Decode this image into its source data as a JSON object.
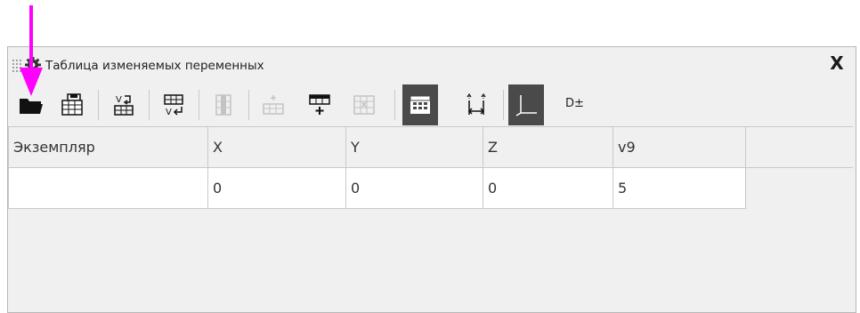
{
  "window": {
    "title": "Таблица изменяемых переменных",
    "close_label": "X"
  },
  "toolbar": {
    "buttons": [
      {
        "icon": "open-folder-icon",
        "state": "enabled"
      },
      {
        "icon": "save-table-icon",
        "state": "enabled"
      },
      {
        "icon": "import-variables-icon",
        "state": "enabled"
      },
      {
        "icon": "export-variables-icon",
        "state": "enabled"
      },
      {
        "icon": "columns-icon",
        "state": "disabled"
      },
      {
        "icon": "add-row-icon",
        "state": "disabled"
      },
      {
        "icon": "insert-row-icon",
        "state": "enabled"
      },
      {
        "icon": "delete-row-icon",
        "state": "disabled"
      },
      {
        "icon": "table-view-icon",
        "state": "active"
      },
      {
        "icon": "dimension-icon",
        "state": "enabled"
      },
      {
        "icon": "axes-icon",
        "state": "active"
      }
    ],
    "tolerance_label": "D±"
  },
  "table": {
    "headers": [
      "Экземпляр",
      "X",
      "Y",
      "Z",
      "v9"
    ],
    "rows": [
      [
        "",
        "0",
        "0",
        "0",
        "5"
      ]
    ]
  },
  "colors": {
    "arrow": "#ff00ff",
    "active_button": "#4a4a4a",
    "panel_bg": "#f0f0f0"
  }
}
